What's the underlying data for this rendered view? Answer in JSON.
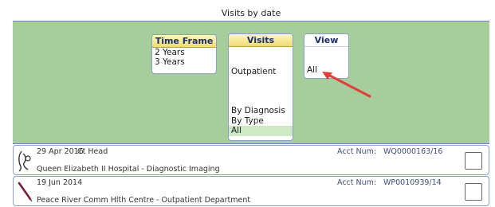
{
  "title": "Visits by date",
  "time_frame": {
    "header": "Time Frame",
    "options": [
      "2 Years",
      "3 Years"
    ]
  },
  "visits": {
    "header": "Visits",
    "options": [
      {
        "label": "",
        "ghost": true
      },
      {
        "label": "",
        "ghost": true
      },
      {
        "label": "Outpatient",
        "ghost": false
      },
      {
        "label": "",
        "ghost": true
      },
      {
        "label": "",
        "ghost": true
      },
      {
        "label": "",
        "ghost": true
      },
      {
        "label": "By Diagnosis",
        "ghost": false
      },
      {
        "label": "By Type",
        "ghost": false
      },
      {
        "label": "All",
        "ghost": false,
        "selected": true
      }
    ]
  },
  "view": {
    "header": "View",
    "options": [
      {
        "label": "",
        "ghost": true
      },
      {
        "label": "",
        "ghost": true
      },
      {
        "label": "All",
        "ghost": false
      }
    ]
  },
  "visits_list": [
    {
      "date": "29 Apr 2016",
      "description": "Ct Head",
      "place": "Queen Elizabeth II Hospital - Diagnostic Imaging",
      "acct_label": "Acct Num:",
      "acct_num": "WQ0000163/16",
      "icon": "scan-icon"
    },
    {
      "date": "19 Jun 2014",
      "description": "",
      "place": "Peace River Comm Hlth Centre - Outpatient Department",
      "acct_label": "Acct Num:",
      "acct_num": "WP0010939/14",
      "icon": "needle-icon"
    }
  ],
  "colors": {
    "panel_bg": "#a8cd9c",
    "header_gold": "#f0dc6c",
    "arrow": "#e0403a",
    "border_blue": "#8aa0c8"
  }
}
